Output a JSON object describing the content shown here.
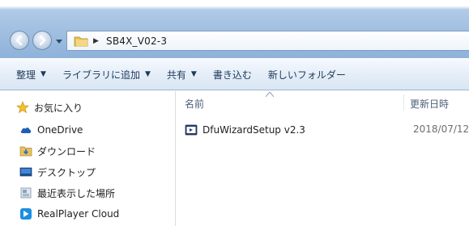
{
  "address": {
    "path": "SB4X_V02-3"
  },
  "toolbar": {
    "organize_label": "整理",
    "include_library_label": "ライブラリに追加",
    "share_label": "共有",
    "burn_label": "書き込む",
    "new_folder_label": "新しいフォルダー"
  },
  "navigation": {
    "favorites_label": "お気に入り",
    "items": [
      {
        "label": "OneDrive",
        "icon": "cloud-icon"
      },
      {
        "label": "ダウンロード",
        "icon": "download-folder-icon"
      },
      {
        "label": "デスクトップ",
        "icon": "desktop-icon"
      },
      {
        "label": "最近表示した場所",
        "icon": "recent-places-icon"
      },
      {
        "label": "RealPlayer Cloud",
        "icon": "realplayer-icon"
      }
    ]
  },
  "file_list": {
    "columns": {
      "name": "名前",
      "date_modified": "更新日時"
    },
    "files": [
      {
        "name": "DfuWizardSetup v2.3",
        "date_modified": "2018/07/12",
        "icon": "installer-icon"
      }
    ]
  },
  "colors": {
    "title_glass": "#a6c3e3",
    "command_text": "#1e395b",
    "column_header_text": "#4c607a",
    "folder_yellow": "#e8c15a"
  }
}
